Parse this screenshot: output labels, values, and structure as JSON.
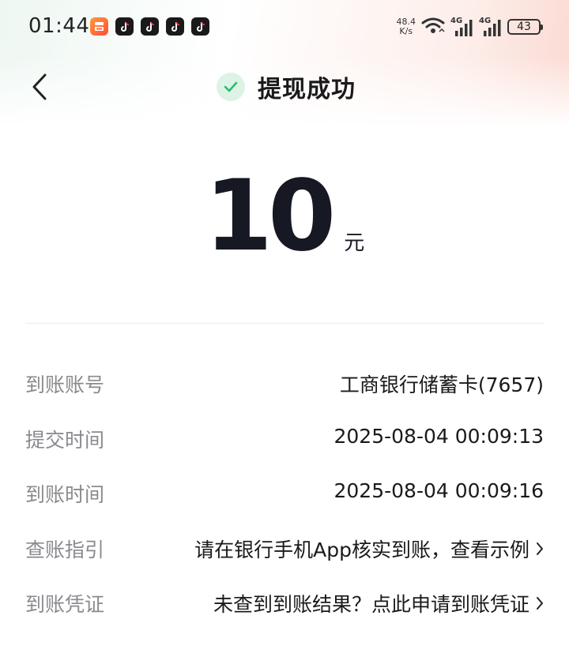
{
  "status_bar": {
    "time": "01:44",
    "notif_icons": [
      "app-notif-icon",
      "douyin-icon",
      "douyin-icon",
      "douyin-icon",
      "douyin-icon"
    ],
    "net_speed_value": "48.4",
    "net_speed_unit": "K/s",
    "signal_1_label": "4G",
    "signal_2_label": "4G",
    "battery_level": "43"
  },
  "header": {
    "title": "提现成功",
    "status_icon": "check-icon",
    "accent_color": "#2ebd6b"
  },
  "amount": {
    "value": "10",
    "unit": "元"
  },
  "details": [
    {
      "label": "到账账号",
      "value": "工商银行储蓄卡(7657)",
      "link": false
    },
    {
      "label": "提交时间",
      "value": "2025-08-04 00:09:13",
      "link": false
    },
    {
      "label": "到账时间",
      "value": "2025-08-04 00:09:16",
      "link": false
    },
    {
      "label": "查账指引",
      "value": "请在银行手机App核实到账，查看示例",
      "link": true
    },
    {
      "label": "到账凭证",
      "value": "未查到到账结果？点此申请到账凭证",
      "link": true
    }
  ]
}
